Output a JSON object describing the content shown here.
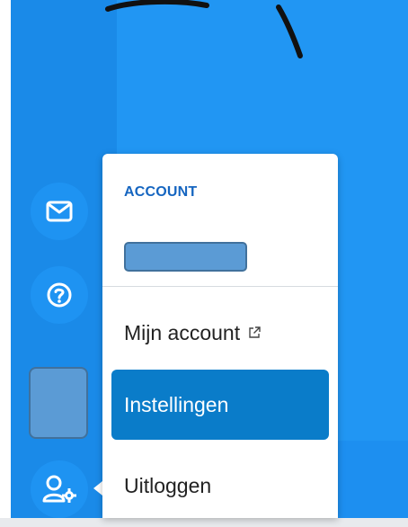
{
  "menu": {
    "header": "ACCOUNT",
    "items": [
      {
        "label": "Mijn account",
        "icon": "external-link-icon"
      },
      {
        "label": "Instellingen",
        "selected": true
      },
      {
        "label": "Uitloggen"
      }
    ]
  },
  "sidebar": {
    "buttons": [
      {
        "icon": "mail-icon"
      },
      {
        "icon": "help-icon"
      },
      {
        "icon": "user-settings-icon"
      }
    ]
  },
  "colors": {
    "sidebar": "#1a8ae8",
    "main": "#2196f3",
    "selected_item": "#0a7cc9",
    "header_text": "#1565c0"
  }
}
